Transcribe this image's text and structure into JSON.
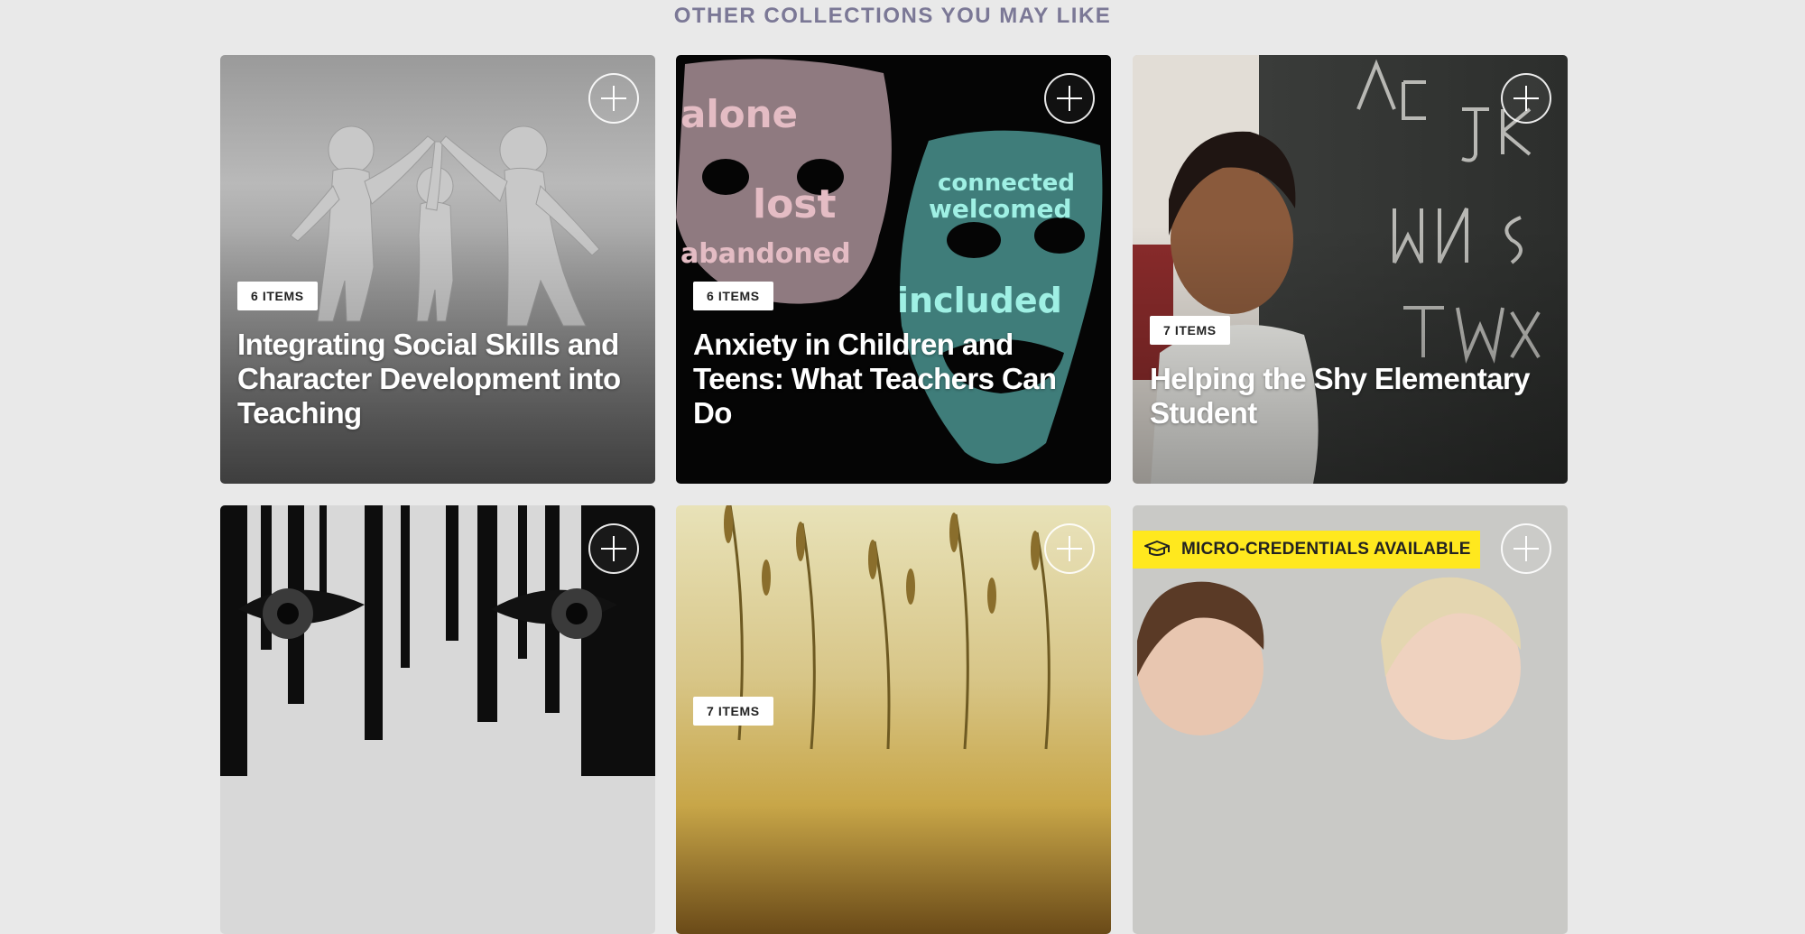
{
  "section": {
    "title": "OTHER COLLECTIONS YOU MAY LIKE"
  },
  "cards": [
    {
      "badge": "6 ITEMS",
      "title": "Integrating Social Skills and Character Development into Teaching",
      "image": "three-figures-high-five-image"
    },
    {
      "badge": "6 ITEMS",
      "title": "Anxiety in Children and Teens: What Teachers Can Do",
      "image": "word-cloud-masks-image"
    },
    {
      "badge": "7 ITEMS",
      "title": "Helping the Shy Elementary Student",
      "image": "girl-at-chalkboard-image"
    },
    {
      "image": "eyes-behind-bars-image"
    },
    {
      "badge": "7 ITEMS",
      "image": "sunset-grass-image"
    },
    {
      "micro_label": "MICRO-CREDENTIALS AVAILABLE",
      "image": "laughing-boys-image"
    }
  ],
  "colors": {
    "heading": "#7b7896",
    "micro_badge": "#ffe81e",
    "page_bg": "#e9e9e9"
  }
}
